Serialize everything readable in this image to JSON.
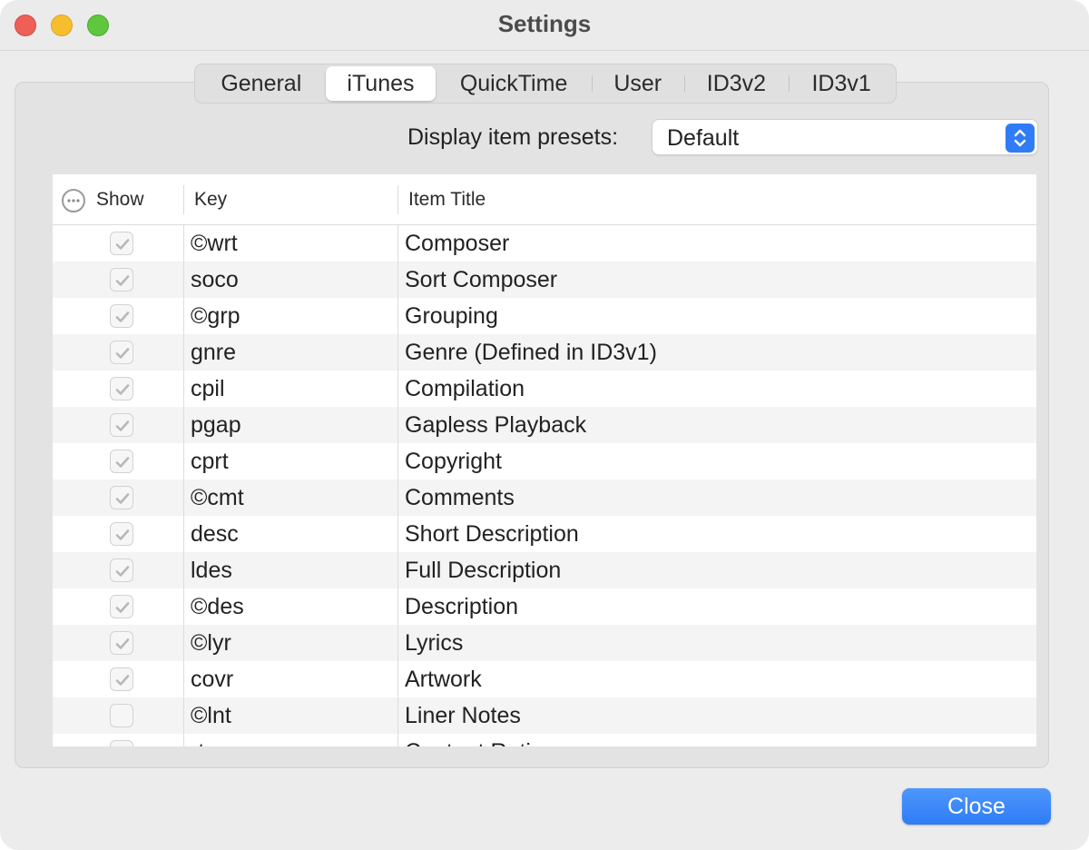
{
  "window": {
    "title": "Settings"
  },
  "tabs": [
    {
      "label": "General",
      "active": false
    },
    {
      "label": "iTunes",
      "active": true
    },
    {
      "label": "QuickTime",
      "active": false
    },
    {
      "label": "User",
      "active": false
    },
    {
      "label": "ID3v2",
      "active": false
    },
    {
      "label": "ID3v1",
      "active": false
    }
  ],
  "presets": {
    "label": "Display item presets:",
    "value": "Default"
  },
  "table": {
    "columns": {
      "show": "Show",
      "key": "Key",
      "title": "Item Title"
    },
    "rows": [
      {
        "checked": true,
        "key": "©wrt",
        "title": "Composer"
      },
      {
        "checked": true,
        "key": "soco",
        "title": "Sort Composer"
      },
      {
        "checked": true,
        "key": "©grp",
        "title": "Grouping"
      },
      {
        "checked": true,
        "key": "gnre",
        "title": "Genre (Defined in ID3v1)"
      },
      {
        "checked": true,
        "key": "cpil",
        "title": "Compilation"
      },
      {
        "checked": true,
        "key": "pgap",
        "title": "Gapless Playback"
      },
      {
        "checked": true,
        "key": "cprt",
        "title": "Copyright"
      },
      {
        "checked": true,
        "key": "©cmt",
        "title": "Comments"
      },
      {
        "checked": true,
        "key": "desc",
        "title": "Short Description"
      },
      {
        "checked": true,
        "key": "ldes",
        "title": "Full Description"
      },
      {
        "checked": true,
        "key": "©des",
        "title": "Description"
      },
      {
        "checked": true,
        "key": "©lyr",
        "title": "Lyrics"
      },
      {
        "checked": true,
        "key": "covr",
        "title": "Artwork"
      },
      {
        "checked": false,
        "key": "©lnt",
        "title": "Liner Notes"
      },
      {
        "checked": true,
        "key": "rtng",
        "title": "Content Rating"
      }
    ]
  },
  "buttons": {
    "close": "Close"
  }
}
